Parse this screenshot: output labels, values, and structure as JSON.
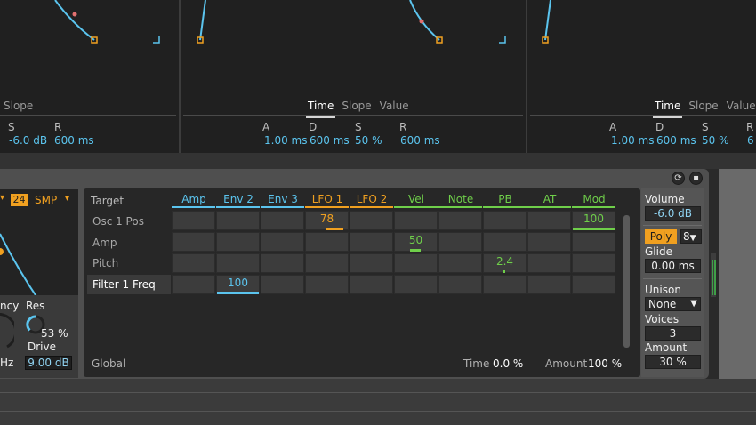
{
  "colors": {
    "blue": "#5bc4ee",
    "orange": "#f0a020",
    "green": "#6fcf4a",
    "cell": "#3c3c3c"
  },
  "env_panels": [
    {
      "tabs": [
        "Slope"
      ],
      "labels": [
        "S",
        "R"
      ],
      "values": [
        "-6.0 dB",
        "600 ms"
      ]
    },
    {
      "tabs": [
        "Time",
        "Slope",
        "Value"
      ],
      "active_tab": "Time",
      "labels": [
        "A",
        "D",
        "S",
        "R"
      ],
      "values": [
        "1.00 ms",
        "600 ms",
        "50 %",
        "600 ms"
      ]
    },
    {
      "tabs": [
        "Time",
        "Slope",
        "Value"
      ],
      "active_tab": "Time",
      "labels": [
        "A",
        "D",
        "S",
        "R"
      ],
      "values": [
        "1.00 ms",
        "600 ms",
        "50 %",
        "6"
      ]
    }
  ],
  "osc": {
    "voices_badge": "24",
    "mode_label": "SMP",
    "freq_label": "ncy",
    "res_label": "Res",
    "res_value": "53 %",
    "drive_label": "Drive",
    "drive_value": "9.00 dB",
    "hz_label": "Hz"
  },
  "matrix": {
    "target_header": "Target",
    "columns": [
      {
        "label": "Amp",
        "color": "blue"
      },
      {
        "label": "Env 2",
        "color": "blue"
      },
      {
        "label": "Env 3",
        "color": "blue"
      },
      {
        "label": "LFO 1",
        "color": "orange"
      },
      {
        "label": "LFO 2",
        "color": "orange"
      },
      {
        "label": "Vel",
        "color": "green"
      },
      {
        "label": "Note",
        "color": "green"
      },
      {
        "label": "PB",
        "color": "green"
      },
      {
        "label": "AT",
        "color": "green"
      },
      {
        "label": "Mod",
        "color": "green"
      }
    ],
    "rows": [
      "Osc 1 Pos",
      "Amp",
      "Pitch",
      "Filter 1 Freq"
    ],
    "selected_row": "Filter 1 Freq",
    "values": [
      {
        "row": 0,
        "col": 3,
        "text": "78",
        "amount": 0.78,
        "color": "orange"
      },
      {
        "row": 0,
        "col": 9,
        "text": "100",
        "amount": 1.0,
        "color": "green"
      },
      {
        "row": 1,
        "col": 5,
        "text": "50",
        "amount": 0.5,
        "color": "green"
      },
      {
        "row": 2,
        "col": 7,
        "text": "2.4",
        "amount": 0.024,
        "color": "green"
      },
      {
        "row": 3,
        "col": 1,
        "text": "100",
        "amount": 1.0,
        "color": "blue"
      }
    ],
    "footer": {
      "global_label": "Global",
      "time_label": "Time",
      "time_value": "0.0 %",
      "amount_label": "Amount",
      "amount_value": "100 %"
    }
  },
  "global_panel": {
    "volume_label": "Volume",
    "volume_value": "-6.0 dB",
    "poly_label": "Poly",
    "poly_voices": "8",
    "glide_label": "Glide",
    "glide_value": "0.00 ms",
    "unison_label": "Unison",
    "unison_value": "None",
    "voices_label": "Voices",
    "voices_value": "3",
    "amount_label": "Amount",
    "amount_value": "30 %"
  }
}
